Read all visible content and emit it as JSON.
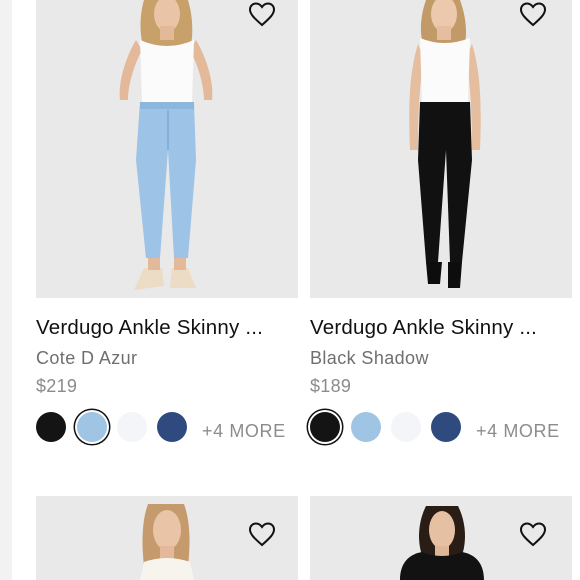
{
  "products": [
    {
      "title": "Verdugo Ankle Skinny ...",
      "color_name": "Cote D Azur",
      "price": "$219",
      "more_label": "+4 MORE",
      "swatches": [
        "#141414",
        "#9fc4e4",
        "#f4f5f8",
        "#2e4a7e"
      ],
      "selected_swatch": 1
    },
    {
      "title": "Verdugo Ankle Skinny ...",
      "color_name": "Black Shadow",
      "price": "$189",
      "more_label": "+4 MORE",
      "swatches": [
        "#141414",
        "#9fc4e4",
        "#f4f5f8",
        "#2e4a7e"
      ],
      "selected_swatch": 0
    }
  ],
  "icons": {
    "favorite": "heart-outline-icon"
  }
}
